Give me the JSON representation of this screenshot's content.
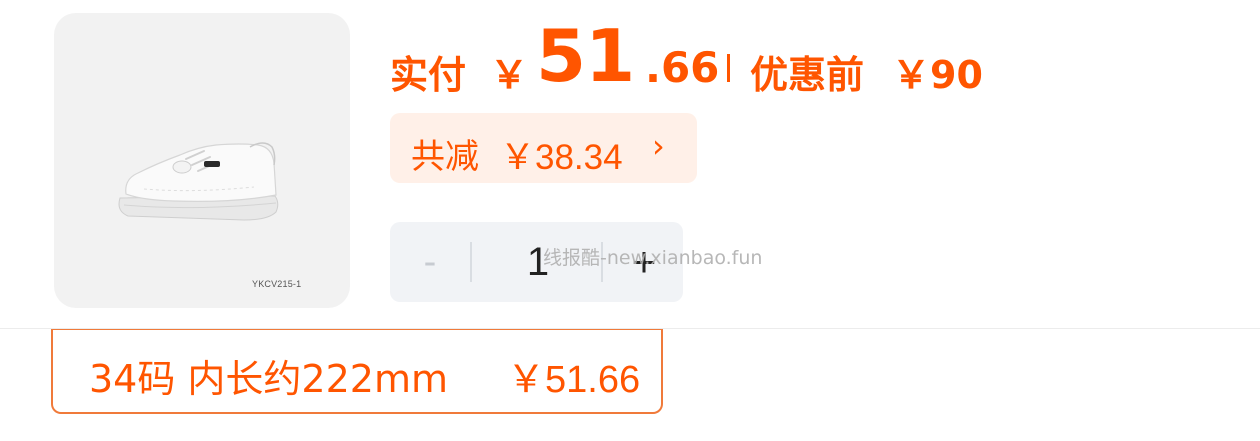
{
  "product": {
    "image_icon": "sneaker-image",
    "sku_code": "YKCV215-1"
  },
  "price": {
    "paid_label": "实付",
    "currency": "￥",
    "paid_integer": "51",
    "paid_decimal": ".66",
    "separator": "|",
    "original_label": "优惠前",
    "original_value": "￥90"
  },
  "discount": {
    "label": "共减",
    "value": "￥38.34",
    "arrow": "›"
  },
  "quantity": {
    "minus": "-",
    "value": "1",
    "plus": "+"
  },
  "watermark": "线报酷-new.xianbao.fun",
  "size_option": {
    "label": "34码 内长约222mm",
    "price": "￥51.66"
  },
  "colors": {
    "accent": "#ff5500",
    "chip_background": "#fff0e8",
    "stepper_background": "#f1f3f6",
    "image_background": "#f2f2f2"
  }
}
